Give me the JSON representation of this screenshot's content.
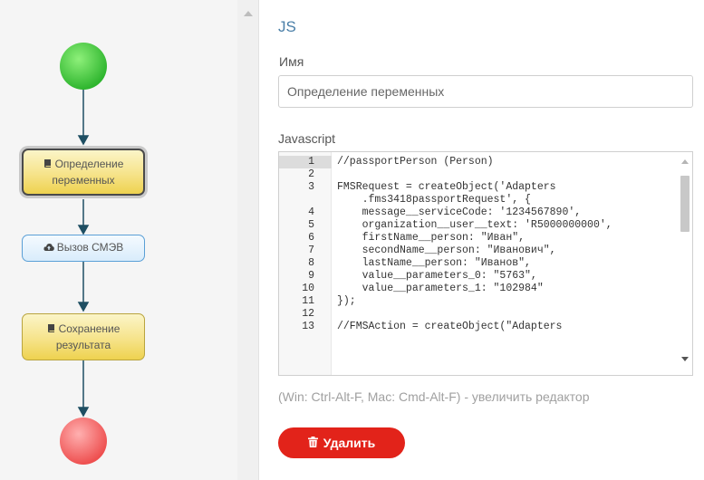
{
  "flow": {
    "nodes": [
      {
        "label": "Определение переменных",
        "icon": "book-icon",
        "selected": true
      },
      {
        "label": "Вызов СМЭВ",
        "icon": "cloud-upload-icon",
        "selected": false
      },
      {
        "label": "Сохранение результата",
        "icon": "book-icon",
        "selected": false
      }
    ],
    "colors": {
      "start": "#3fbf3f",
      "end": "#f05a5a",
      "connector": "#1f4f63"
    }
  },
  "panel": {
    "title": "JS",
    "name_label": "Имя",
    "name_value": "Определение переменных",
    "code_label": "Javascript",
    "code_lines": [
      {
        "n": "1",
        "text": "//passportPerson (Person)"
      },
      {
        "n": "2",
        "text": ""
      },
      {
        "n": "3",
        "text": "FMSRequest = createObject('Adapters"
      },
      {
        "n": "",
        "text": "    .fms3418passportRequest', {"
      },
      {
        "n": "4",
        "text": "    message__serviceCode: '1234567890',"
      },
      {
        "n": "5",
        "text": "    organization__user__text: 'R5000000000',"
      },
      {
        "n": "6",
        "text": "    firstName__person: \"Иван\","
      },
      {
        "n": "7",
        "text": "    secondName__person: \"Иванович\","
      },
      {
        "n": "8",
        "text": "    lastName__person: \"Иванов\","
      },
      {
        "n": "9",
        "text": "    value__parameters_0: \"5763\","
      },
      {
        "n": "10",
        "text": "    value__parameters_1: \"102984\""
      },
      {
        "n": "11",
        "text": "});"
      },
      {
        "n": "12",
        "text": ""
      },
      {
        "n": "13",
        "text": "//FMSAction = createObject(\"Adapters"
      }
    ],
    "hint": "(Win: Ctrl-Alt-F, Mac: Cmd-Alt-F) - увеличить редактор",
    "delete_label": "Удалить",
    "accent_color": "#4a7fa8",
    "delete_color": "#e2231a"
  }
}
